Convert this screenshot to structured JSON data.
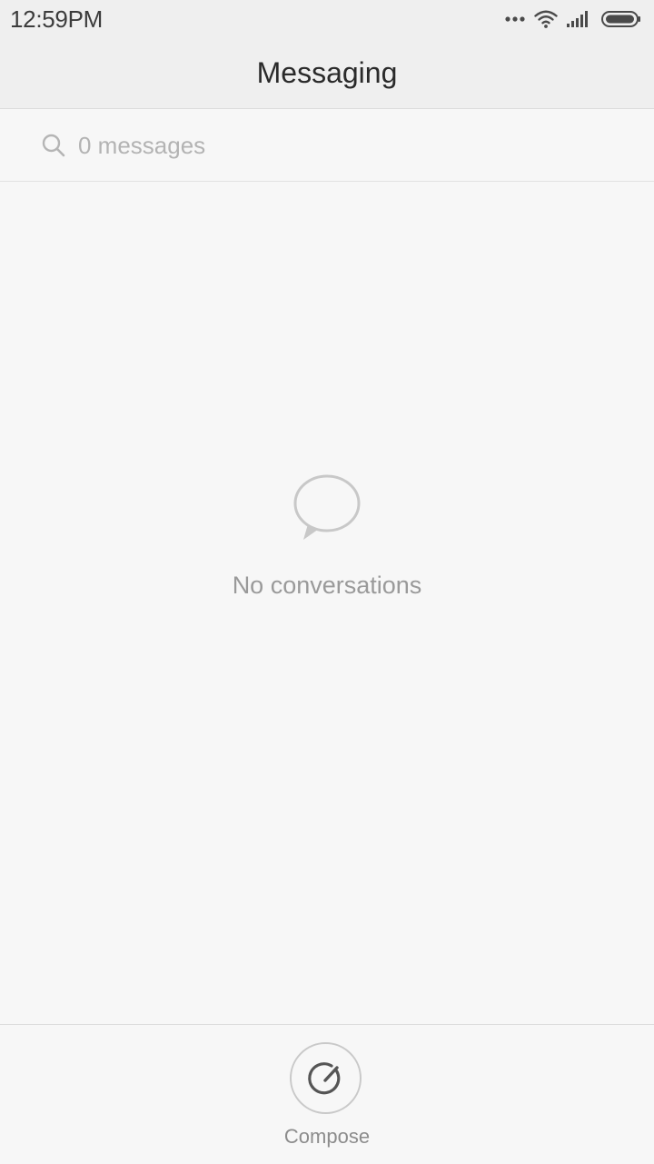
{
  "status_bar": {
    "time": "12:59PM",
    "icons": [
      "more-dots-icon",
      "wifi-icon",
      "signal-icon",
      "battery-icon"
    ]
  },
  "header": {
    "title": "Messaging"
  },
  "search": {
    "placeholder": "0 messages",
    "icon": "search-icon"
  },
  "empty_state": {
    "icon": "speech-bubble-icon",
    "text": "No conversations"
  },
  "bottom_bar": {
    "compose_label": "Compose",
    "compose_icon": "compose-icon"
  },
  "colors": {
    "background": "#f7f7f7",
    "header_background": "#efefef",
    "title_text": "#2a2a2a",
    "muted_text": "#9a9a9a",
    "divider": "#dcdcdc"
  }
}
